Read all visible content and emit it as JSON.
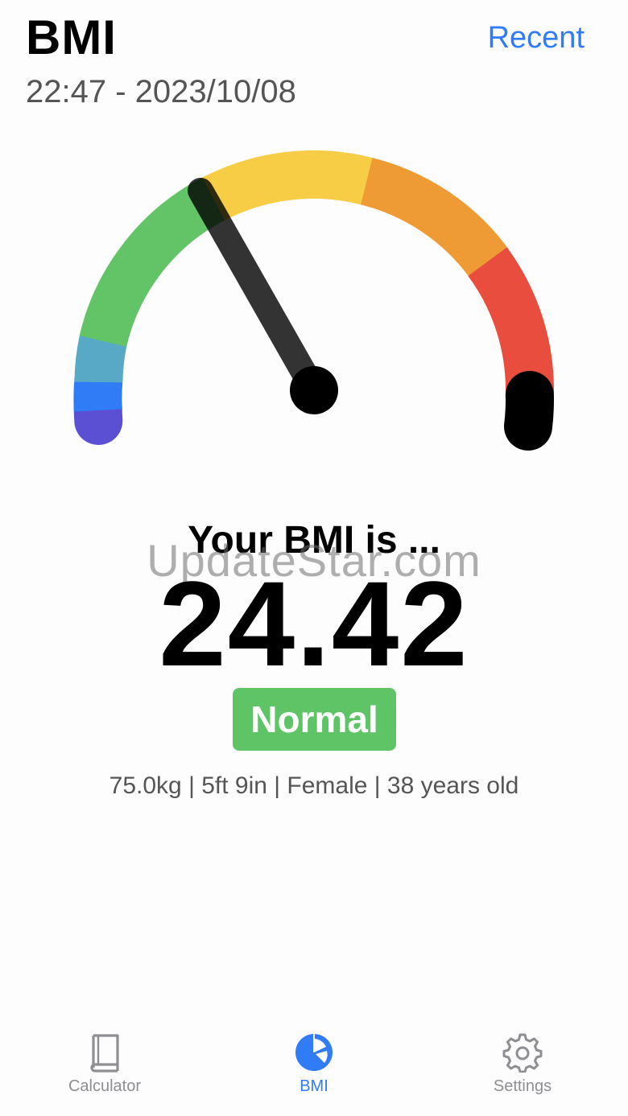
{
  "header": {
    "title": "BMI",
    "recent_label": "Recent",
    "timestamp": "22:47 - 2023/10/08"
  },
  "gauge": {
    "value": 24.42,
    "segment_colors": [
      "#5b4fd3",
      "#2f7cf6",
      "#57a9c6",
      "#62c466",
      "#f6cd45",
      "#ef9b35",
      "#e84d3d",
      "#000000"
    ]
  },
  "result": {
    "heading": "Your BMI is ...",
    "value": "24.42",
    "category": "Normal",
    "category_color": "#5ec465",
    "details": "75.0kg | 5ft 9in | Female | 38 years old"
  },
  "watermark": "UpdateStar.com",
  "tabbar": {
    "tabs": [
      {
        "label": "Calculator",
        "icon": "book-icon",
        "active": false
      },
      {
        "label": "BMI",
        "icon": "pie-chart-icon",
        "active": true
      },
      {
        "label": "Settings",
        "icon": "gear-icon",
        "active": false
      }
    ],
    "active_color": "#2f7cf6",
    "inactive_color": "#8e8e93"
  }
}
